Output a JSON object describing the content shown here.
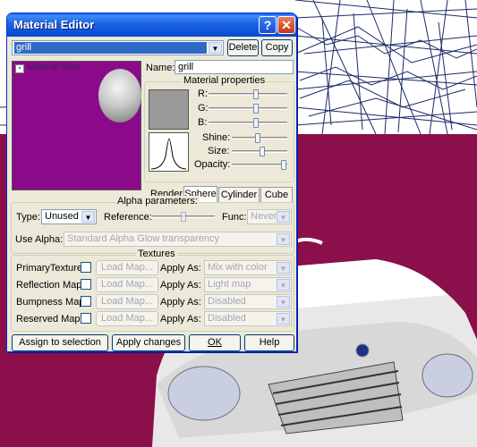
{
  "window": {
    "title": "Material Editor"
  },
  "title_buttons": {
    "help": "?",
    "close": "✕"
  },
  "material_select": {
    "value": "grill"
  },
  "toolbar": {
    "delete_label": "Delete",
    "copy_label": "Copy"
  },
  "material_view": {
    "title": "Material View"
  },
  "name": {
    "label": "Name:",
    "value": "grill"
  },
  "material_properties": {
    "title": "Material properties",
    "r_label": "R:",
    "g_label": "G:",
    "b_label": "B:",
    "shine_label": "Shine:",
    "size_label": "Size:",
    "opacity_label": "Opacity:"
  },
  "render": {
    "label": "Render:",
    "tabs": [
      "Sphere",
      "Cylinder",
      "Cube"
    ],
    "active": "Sphere"
  },
  "alpha": {
    "title": "Alpha parameters:",
    "type_label": "Type:",
    "type_value": "Unused",
    "reference_label": "Reference:",
    "func_label": "Func:",
    "func_value": "Never",
    "use_alpha_label": "Use Alpha:",
    "use_alpha_value": "Standard Alpha Glow transparency"
  },
  "textures": {
    "title": "Textures",
    "apply_as_label": "Apply As:",
    "load_map_label": "Load Map...",
    "rows": [
      {
        "label": "PrimaryTexture",
        "apply": "Mix with color"
      },
      {
        "label": "Reflection Map",
        "apply": "Light map"
      },
      {
        "label": "Bumpness Map",
        "apply": "Disabled"
      },
      {
        "label": "Reserved Map",
        "apply": "Disabled"
      }
    ]
  },
  "footer": {
    "assign_label": "Assign to selection",
    "apply_label": "Apply changes",
    "ok_label": "OK",
    "help_label": "Help"
  },
  "colors": {
    "viewport_bg": "#8a0f4a",
    "preview_bg": "#8b0a8a",
    "title_blue": "#0a4ed6"
  }
}
